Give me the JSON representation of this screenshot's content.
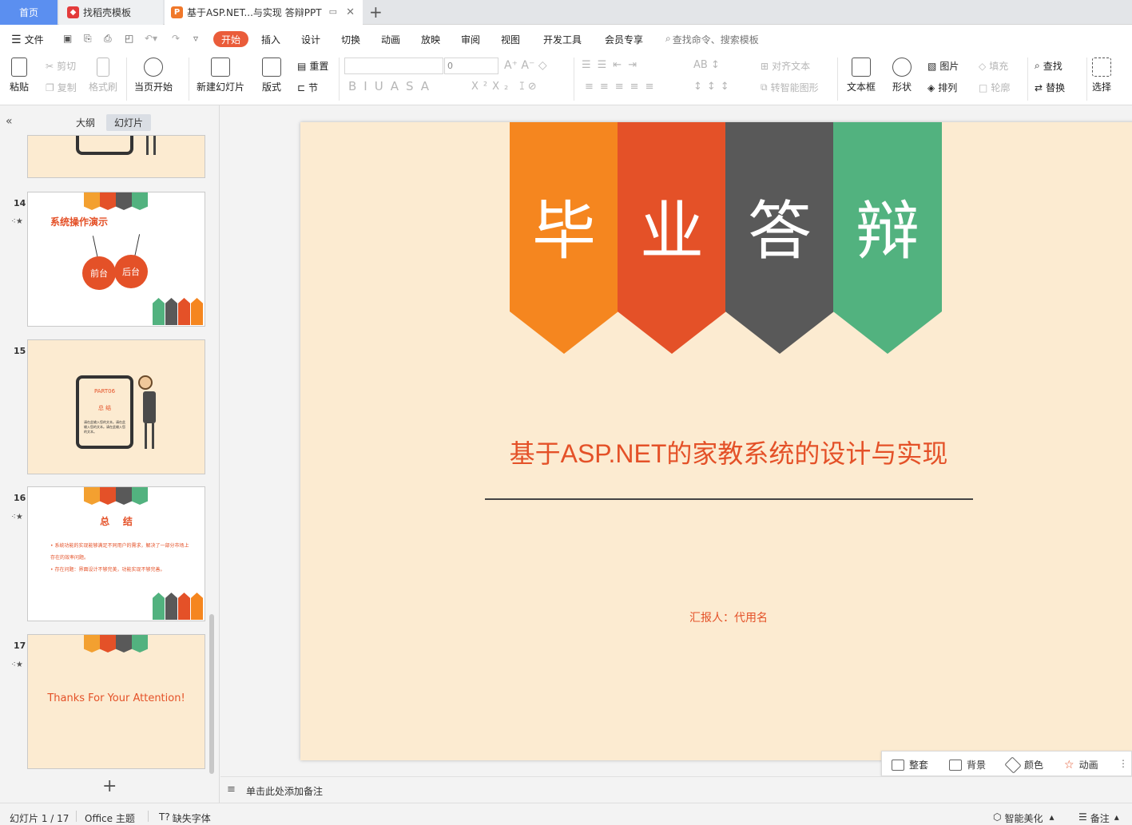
{
  "tabs": {
    "home": "首页",
    "templates": "找稻壳模板",
    "doc": "基于ASP.NET...与实现 答辩PPT",
    "new_tab": "+"
  },
  "menu": {
    "file": "文件",
    "items": [
      "开始",
      "插入",
      "设计",
      "切换",
      "动画",
      "放映",
      "审阅",
      "视图",
      "开发工具",
      "会员专享"
    ],
    "search_placeholder": "查找命令、搜索模板"
  },
  "ribbon": {
    "paste": "粘贴",
    "cut": "剪切",
    "copy": "复制",
    "format_painter": "格式刷",
    "from_start": "当页开始",
    "new_slide": "新建幻灯片",
    "layout": "版式",
    "reset": "重置",
    "section": "节",
    "font_size": "0",
    "align_text": "对齐文本",
    "smart_graphic": "转智能图形",
    "textbox": "文本框",
    "shape": "形状",
    "picture": "图片",
    "arrange": "排列",
    "fill": "填充",
    "outline": "轮廓",
    "find": "查找",
    "replace": "替换",
    "select": "选择"
  },
  "panel": {
    "outline_tab": "大纲",
    "slides_tab": "幻灯片",
    "add": "+"
  },
  "thumbnails": [
    {
      "num": "14",
      "title": "系统操作演示",
      "tag1": "前台",
      "tag2": "后台"
    },
    {
      "num": "15",
      "part": "PART06",
      "heading": "总  结",
      "body": "请在此输入您的文本。请在此输入您的文本。请在此输入您的文本。"
    },
    {
      "num": "16",
      "title": "总    结",
      "bullets": [
        "系统功能的实现能够满足不同用户的需求，解决了一部分市场上存在的效率问题。",
        "存在问题：界面设计不够完美，功能实现不够完善。"
      ]
    },
    {
      "num": "17",
      "text": "Thanks For Your Attention!"
    }
  ],
  "slide": {
    "chars": [
      "毕",
      "业",
      "答",
      "辩"
    ],
    "subtitle": "基于ASP.NET的家教系统的设计与实现",
    "reporter": "汇报人：代用名"
  },
  "colors": {
    "orange": "#f5861f",
    "red": "#e45128",
    "gray": "#595959",
    "green": "#52b27f",
    "slide_bg": "#fcebd1",
    "accent": "#ea5c3a"
  },
  "floatbar": {
    "layout": "整套",
    "background": "背景",
    "color": "颜色",
    "animation": "动画"
  },
  "notes": {
    "placeholder": "单击此处添加备注"
  },
  "status": {
    "slide_pos": "幻灯片 1 / 17",
    "theme": "Office 主题",
    "missing_font": "缺失字体",
    "beautify": "智能美化",
    "notes": "备注"
  }
}
